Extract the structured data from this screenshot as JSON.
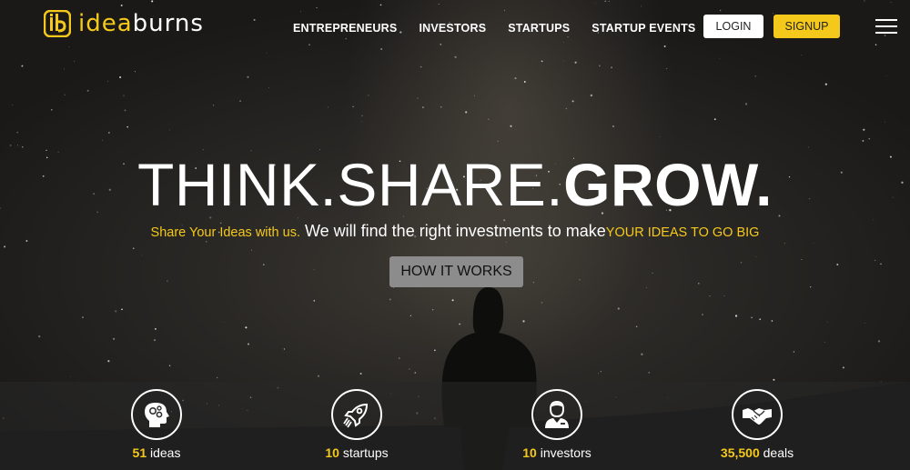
{
  "brand": {
    "part1": "idea",
    "part2": "burns",
    "mark": "ib"
  },
  "nav": {
    "items": [
      {
        "label": "ENTREPRENEURS"
      },
      {
        "label": "INVESTORS"
      },
      {
        "label": "STARTUPS"
      },
      {
        "label": "STARTUP EVENTS"
      }
    ],
    "login_label": "LOGIN",
    "signup_label": "SIGNUP"
  },
  "hero": {
    "headline_part1": "THINK.SHARE.",
    "headline_part2": "GROW.",
    "tagline_part1": "Share Your Ideas with us.",
    "tagline_part2": " We will find the right investments to make",
    "tagline_part3": "YOUR IDEAS TO GO BIG",
    "cta_label": "HOW IT WORKS"
  },
  "stats": [
    {
      "count": "51",
      "label": " ideas",
      "icon": "head-gears-icon"
    },
    {
      "count": "10",
      "label": " startups",
      "icon": "rocket-icon"
    },
    {
      "count": "10",
      "label": " investors",
      "icon": "businessman-icon"
    },
    {
      "count": "35,500",
      "label": " deals",
      "icon": "handshake-icon"
    }
  ],
  "colors": {
    "accent": "#f5c91b",
    "background": "#1b1b1a",
    "button_gray": "#8c8c8c"
  }
}
